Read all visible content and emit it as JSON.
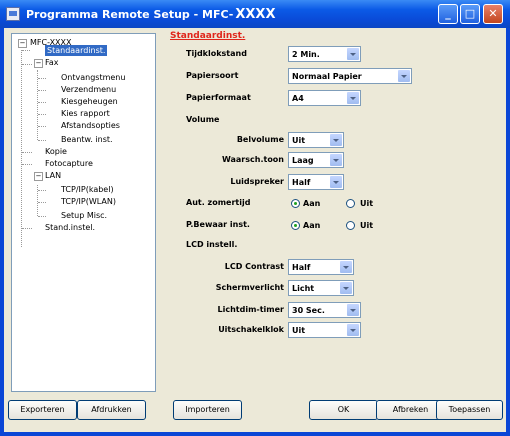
{
  "window": {
    "title": "Programma Remote Setup - MFC-",
    "title_model": "XXXX",
    "minimize_glyph": "_",
    "maximize_glyph": "□",
    "close_glyph": "✕"
  },
  "tree": {
    "expander_open": "−",
    "root": "MFC-XXXX",
    "items": {
      "standaardinst": "Standaardinst.",
      "fax": "Fax",
      "ontvangstmenu": "Ontvangstmenu",
      "verzendmenu": "Verzendmenu",
      "kiesgeheugen": "Kiesgeheugen",
      "kies_rapport": "Kies rapport",
      "afstandsopties": "Afstandsopties",
      "beantw_inst": "Beantw. inst.",
      "kopie": "Kopie",
      "fotocapture": "Fotocapture",
      "lan": "LAN",
      "tcpip_kabel": "TCP/IP(kabel)",
      "tcpip_wlan": "TCP/IP(WLAN)",
      "setup_misc": "Setup Misc.",
      "stand_instel": "Stand.instel."
    }
  },
  "panel": {
    "title": "Standaardinst.",
    "tijdklokstand": {
      "label": "Tijdklokstand",
      "value": "2 Min."
    },
    "papiersoort": {
      "label": "Papiersoort",
      "value": "Normaal Papier"
    },
    "papierformaat": {
      "label": "Papierformaat",
      "value": "A4"
    },
    "volume_heading": "Volume",
    "belvolume": {
      "label": "Belvolume",
      "value": "Uit"
    },
    "waarsch_toon": {
      "label": "Waarsch.toon",
      "value": "Laag"
    },
    "luidspreker": {
      "label": "Luidspreker",
      "value": "Half"
    },
    "aut_zomertijd": {
      "label": "Aut. zomertijd",
      "on_label": "Aan",
      "off_label": "Uit",
      "selected": "Aan"
    },
    "p_bewaar_inst": {
      "label": "P.Bewaar inst.",
      "on_label": "Aan",
      "off_label": "Uit",
      "selected": "Aan"
    },
    "lcd_heading": "LCD instell.",
    "lcd_contrast": {
      "label": "LCD Contrast",
      "value": "Half"
    },
    "schermverlicht": {
      "label": "Schermverlicht",
      "value": "Licht"
    },
    "lichtdim_timer": {
      "label": "Lichtdim-timer",
      "value": "30 Sec."
    },
    "uitschakelklok": {
      "label": "Uitschakelklok",
      "value": "Uit"
    }
  },
  "buttons": {
    "exporteren": "Exporteren",
    "afdrukken": "Afdrukken",
    "importeren": "Importeren",
    "ok": "OK",
    "afbreken": "Afbreken",
    "toepassen": "Toepassen"
  },
  "colors": {
    "titlebar": "#0a4bd8",
    "panel_title": "#e0261b",
    "selection": "#316ac5",
    "dialog_bg": "#ece9d8"
  }
}
